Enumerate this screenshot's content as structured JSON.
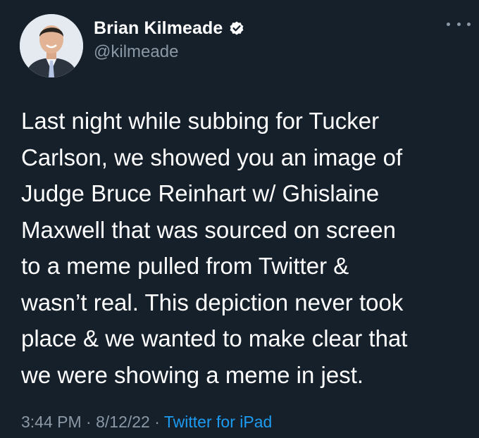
{
  "author": {
    "display_name": "Brian Kilmeade",
    "handle": "@kilmeade",
    "verified": true,
    "avatar_icon": "profile-photo"
  },
  "more_icon": "more-dots-icon",
  "tweet": {
    "lines": [
      "Last night while subbing for Tucker",
      "Carlson, we showed you an image of",
      "Judge Bruce Reinhart w/ Ghislaine",
      "Maxwell that was sourced on screen",
      "to a meme pulled from Twitter &",
      "wasn’t real. This depiction never took",
      "place & we wanted to make clear that",
      "we were showing a meme in jest."
    ]
  },
  "meta": {
    "time": "3:44 PM",
    "separator": " · ",
    "date": "8/12/22",
    "source": "Twitter for iPad"
  },
  "colors": {
    "background": "#15202b",
    "secondary_text": "#8b98a5",
    "link": "#1d9bf0",
    "verified_badge": "#ffffff"
  }
}
